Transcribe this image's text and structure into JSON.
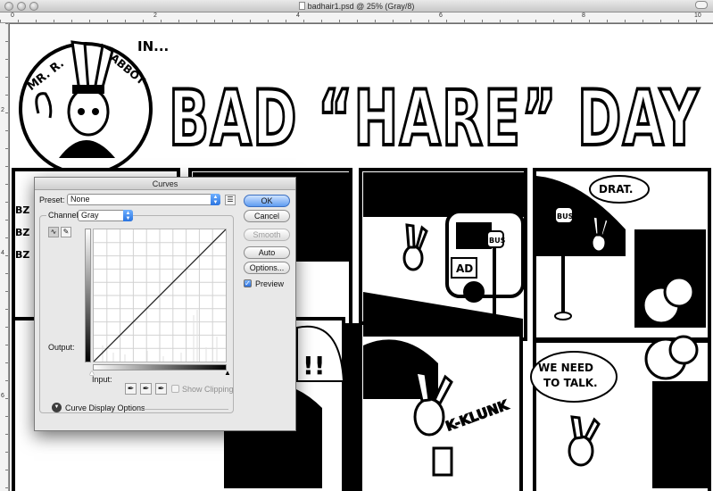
{
  "window": {
    "title": "badhair1.psd @ 25% (Gray/8)",
    "ruler_numbers": [
      "0",
      "2",
      "4",
      "6",
      "8",
      "10"
    ],
    "ruler_left_numbers": [
      "2",
      "4",
      "6"
    ]
  },
  "comic": {
    "mr_label": "MR. R.",
    "abbot_label": "ABBOT",
    "in_label": "IN...",
    "title": "BAD “HARE” DAY",
    "bubble_drat": "DRAT.",
    "bubble_need": "WE NEED",
    "bubble_talk": "TO TALK.",
    "sfx_klunk": "K-KLUNK",
    "bus_sign": "BUS",
    "bus_ad": "AD",
    "buzz_1": "BZ",
    "buzz_2": "BZ",
    "buzz_3": "BZ",
    "exclaim": "!!"
  },
  "curves": {
    "title": "Curves",
    "preset_label": "Preset:",
    "preset_value": "None",
    "channel_label": "Channel:",
    "channel_value": "Gray",
    "output_label": "Output:",
    "input_label": "Input:",
    "buttons": {
      "ok": "OK",
      "cancel": "Cancel",
      "smooth": "Smooth",
      "auto": "Auto",
      "options": "Options..."
    },
    "preview_label": "Preview",
    "preview_checked": true,
    "show_clipping_label": "Show Clipping",
    "show_clipping_checked": false,
    "curve_display_options_label": "Curve Display Options",
    "accent_color": "#2b6fdd"
  }
}
